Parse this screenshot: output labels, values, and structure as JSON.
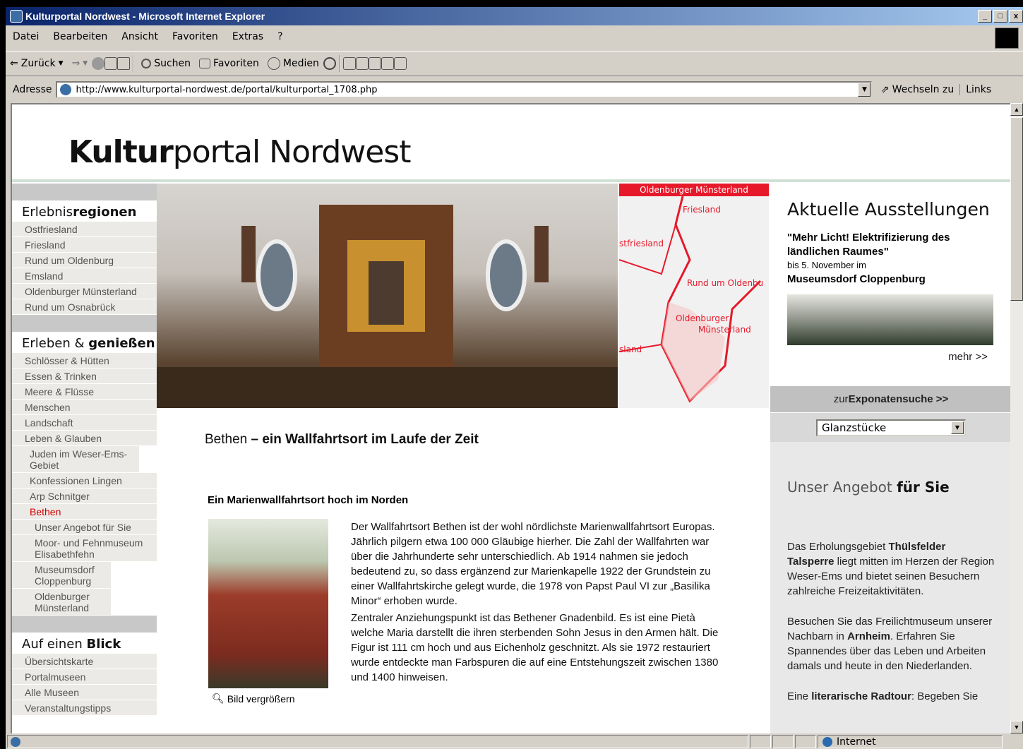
{
  "window": {
    "title": "Kulturportal Nordwest - Microsoft Internet Explorer",
    "buttons": [
      "_",
      "□",
      "x"
    ]
  },
  "menu": [
    "Datei",
    "Bearbeiten",
    "Ansicht",
    "Favoriten",
    "Extras",
    "?"
  ],
  "toolbar": {
    "back": "Zurück",
    "search": "Suchen",
    "favorites": "Favoriten",
    "media": "Medien"
  },
  "address": {
    "label": "Adresse",
    "url": "http://www.kulturportal-nordwest.de/portal/kulturportal_1708.php",
    "go": "Wechseln zu",
    "links": "Links"
  },
  "logo": {
    "bold": "Kultur",
    "rest": "portal Nordwest"
  },
  "nav": {
    "erlebnis": {
      "head_plain": "Erlebnis",
      "head_bold": "regionen",
      "items": [
        "Ostfriesland",
        "Friesland",
        "Rund um Oldenburg",
        "Emsland",
        "Oldenburger Münsterland",
        "Rund um Osnabrück"
      ]
    },
    "erleben": {
      "head_plain": "Erleben & ",
      "head_bold": "genießen",
      "items": [
        "Schlösser & Hütten",
        "Essen & Trinken",
        "Meere & Flüsse",
        "Menschen",
        "Landschaft",
        "Leben & Glauben"
      ],
      "sub": [
        "Juden im Weser-Ems-Gebiet",
        "Konfessionen Lingen",
        "Arp Schnitger",
        "Bethen"
      ],
      "subsub": [
        "Unser Angebot für Sie",
        "Moor- und Fehnmuseum Elisabethfehn",
        "Museumsdorf Cloppenburg",
        "Oldenburger Münsterland"
      ]
    },
    "blick": {
      "head_plain": "Auf einen ",
      "head_bold": "Blick",
      "items": [
        "Übersichtskarte",
        "Portalmuseen",
        "Alle Museen",
        "Veranstaltungstipps"
      ]
    }
  },
  "map": {
    "title": "Oldenburger Münsterland",
    "labels": [
      "Friesland",
      "stfriesland",
      "Rund um Oldenbu",
      "Oldenburger",
      "Münsterland",
      "sland"
    ]
  },
  "main": {
    "title_plain": "Bethen ",
    "title_bold": "– ein Wallfahrtsort im Laufe der Zeit",
    "subtitle": "Ein Marienwallfahrtsort hoch im Norden",
    "enlarge": "Bild vergrößern",
    "para1": "Der Wallfahrtsort Bethen ist der wohl nördlichste Marienwallfahrtsort Europas. Jährlich pilgern etwa 100 000 Gläubige hierher. Die Zahl der Wallfahrten war über die Jahrhunderte sehr unterschiedlich. Ab 1914 nahmen sie jedoch bedeutend zu, so dass ergänzend zur Marienkapelle 1922 der Grundstein zu einer Wallfahrtskirche gelegt wurde, die 1978 von Papst Paul VI zur „Basilika Minor“ erhoben wurde.",
    "para2": "Zentraler Anziehungspunkt ist das Bethener Gnadenbild. Es ist eine Pietà welche Maria darstellt die ihren sterbenden Sohn Jesus in den Armen hält. Die Figur ist 111 cm hoch und aus Eichenholz geschnitzt. Als sie 1972 restauriert wurde entdeckte man Farbspuren die auf eine Entstehungszeit zwischen 1380 und 1400 hinweisen."
  },
  "right": {
    "heading": "Aktuelle Ausstellungen",
    "title1": "\"Mehr Licht! Elektrifizierung des ländlichen Raumes\"",
    "date": "bis 5. November im",
    "place": "Museumsdorf Cloppenburg",
    "more": "mehr >>",
    "expo_plain": "zur ",
    "expo_bold": "Exponatensuche >>",
    "select": "Glanzstücke",
    "angebot_plain": "Unser Angebot ",
    "angebot_bold": "für Sie",
    "p1a": "Das Erholungsgebiet ",
    "p1b": "Thülsfelder Talsperre",
    "p1c": " liegt mitten im Herzen der Region Weser-Ems und bietet seinen Besuchern zahlreiche Freizeitaktivitäten.",
    "p2a": "Besuchen Sie das Freilichtmuseum unserer Nachbarn in ",
    "p2b": "Arnheim",
    "p2c": ". Erfahren Sie Spannendes über das Leben und Arbeiten damals und heute in den Niederlanden.",
    "p3a": "Eine ",
    "p3b": "literarische Radtour",
    "p3c": ": Begeben Sie"
  },
  "status": {
    "zone": "Internet"
  }
}
